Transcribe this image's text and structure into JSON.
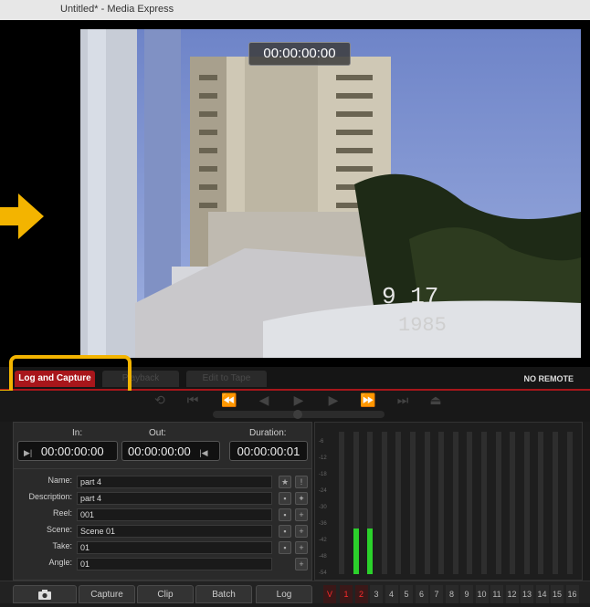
{
  "window": {
    "title": "Untitled* - Media Express"
  },
  "preview": {
    "timecode": "00:00:00:00",
    "date_overlay_day": "9 17",
    "date_overlay_year": "1985"
  },
  "tabs": {
    "log_capture": "Log and Capture",
    "playback": "Playback",
    "edit_to_tape": "Edit to Tape",
    "remote_status": "NO REMOTE"
  },
  "timecodes": {
    "in_label": "In:",
    "out_label": "Out:",
    "duration_label": "Duration:",
    "in_value": "00:00:00:00",
    "out_value": "00:00:00:00",
    "duration_value": "00:00:00:01"
  },
  "fields": [
    {
      "label": "Name:",
      "value": "part 4"
    },
    {
      "label": "Description:",
      "value": "part 4"
    },
    {
      "label": "Reel:",
      "value": "001"
    },
    {
      "label": "Scene:",
      "value": "Scene 01"
    },
    {
      "label": "Take:",
      "value": "01"
    },
    {
      "label": "Angle:",
      "value": "01"
    }
  ],
  "buttons": {
    "capture": "Capture",
    "clip": "Clip",
    "batch": "Batch",
    "log": "Log"
  },
  "channels": {
    "video": "V",
    "audio": [
      "1",
      "2",
      "3",
      "4",
      "5",
      "6",
      "7",
      "8",
      "9",
      "10",
      "11",
      "12",
      "13",
      "14",
      "15",
      "16"
    ]
  },
  "meters": {
    "levels": [
      0.0,
      0.32,
      0.32,
      0.0,
      0.0,
      0.0,
      0.0,
      0.0,
      0.0,
      0.0,
      0.0,
      0.0,
      0.0,
      0.0,
      0.0,
      0.0,
      0.0
    ],
    "db_labels": [
      "-6",
      "-12",
      "-18",
      "-24",
      "-30",
      "-36",
      "-42",
      "-48",
      "-54"
    ]
  },
  "colors": {
    "accent": "#a8161b",
    "highlight": "#f3b400",
    "meter_green": "#2bd12b"
  }
}
